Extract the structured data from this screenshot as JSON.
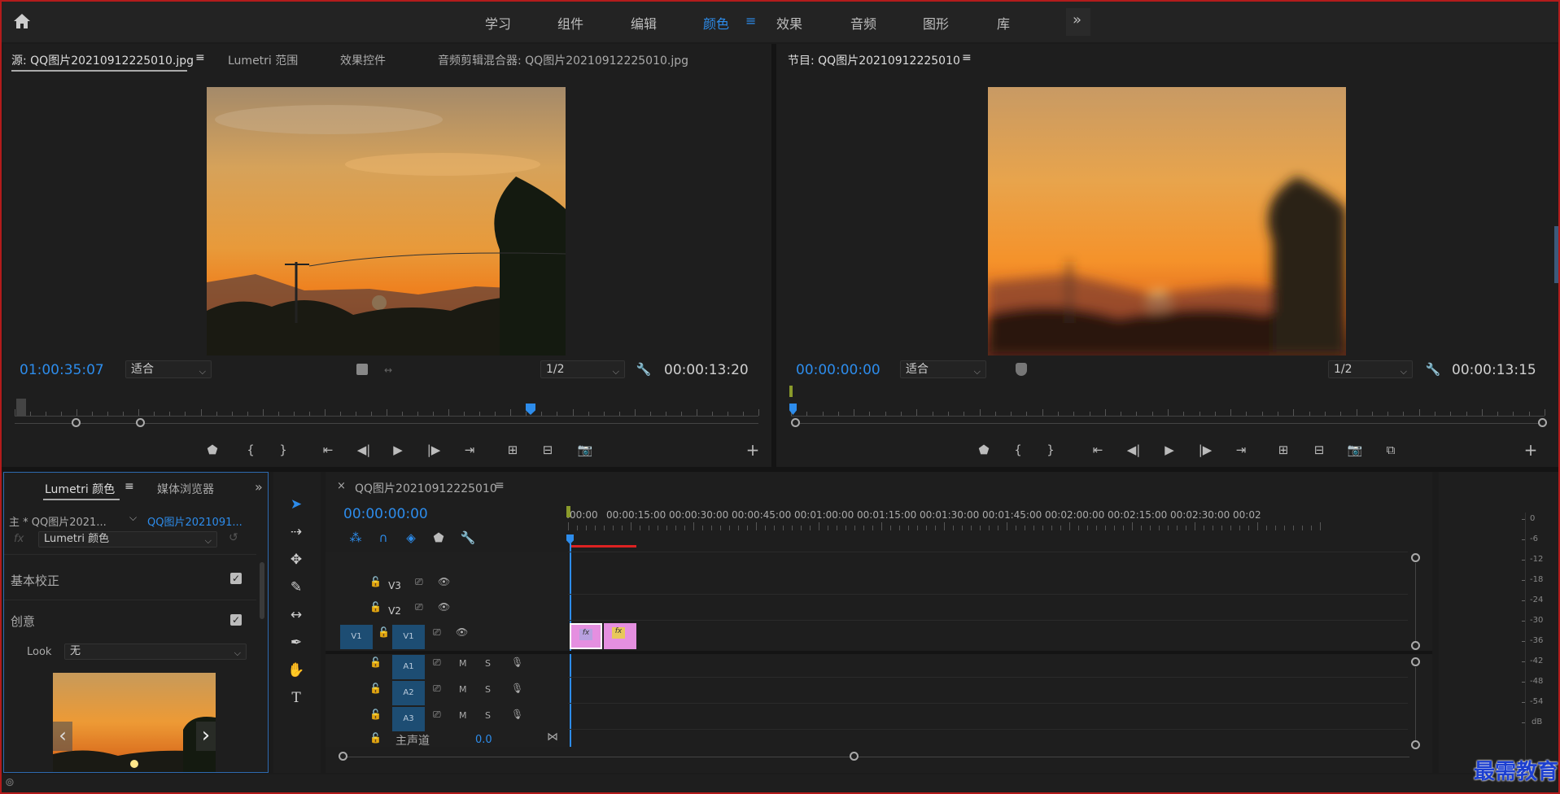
{
  "workspaces": {
    "home_icon": "home-icon",
    "items": [
      "学习",
      "组件",
      "编辑",
      "颜色",
      "效果",
      "音频",
      "图形",
      "库"
    ],
    "active": "颜色",
    "more": "»"
  },
  "source_panel": {
    "tabs": [
      "源: QQ图片20210912225010.jpg",
      "Lumetri 范围",
      "效果控件",
      "音频剪辑混合器: QQ图片20210912225010.jpg"
    ],
    "timecode": "01:00:35:07",
    "fit": "适合",
    "resolution": "1/2",
    "duration": "00:00:13:20"
  },
  "program_panel": {
    "title": "节目: QQ图片20210912225010",
    "timecode": "00:00:00:00",
    "fit": "适合",
    "resolution": "1/2",
    "duration": "00:00:13:15"
  },
  "lumetri": {
    "tabs": [
      "Lumetri 颜色",
      "媒体浏览器"
    ],
    "master_label": "主 * QQ图片2021...",
    "clip_label": "QQ图片2021091...",
    "fx_label": "fx",
    "effect_select": "Lumetri 颜色",
    "sections": [
      "基本校正",
      "创意"
    ],
    "look_label": "Look",
    "look_value": "无"
  },
  "timeline": {
    "close": "×",
    "title": "QQ图片20210912225010",
    "timecode": "00:00:00:00",
    "ruler_labels": [
      ":00:00",
      "00:00:15:00",
      "00:00:30:00",
      "00:00:45:00",
      "00:01:00:00",
      "00:01:15:00",
      "00:01:30:00",
      "00:01:45:00",
      "00:02:00:00",
      "00:02:15:00",
      "00:02:30:00",
      "00:02"
    ],
    "video_tracks": [
      "V3",
      "V2",
      "V1"
    ],
    "source_patch": "V1",
    "audio_tracks": [
      "A1",
      "A2",
      "A3"
    ],
    "track_m": "M",
    "track_s": "S",
    "master_label": "主声道",
    "master_value": "0.0",
    "clip_fx": "fx"
  },
  "meter": {
    "labels": [
      "0",
      "-6",
      "-12",
      "-18",
      "-24",
      "-30",
      "-36",
      "-42",
      "-48",
      "-54",
      "dB"
    ]
  },
  "watermark": "最需教育",
  "colors": {
    "accent": "#2d8ceb",
    "clip_pink": "#e58fe0",
    "track_blue": "#1d4d73"
  }
}
